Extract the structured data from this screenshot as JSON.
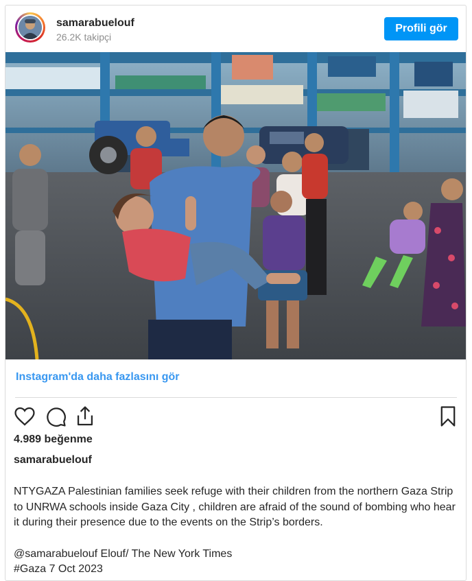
{
  "post": {
    "username": "samarabuelouf",
    "followers": "26.2K takipçi",
    "profile_button": "Profili gör",
    "photo_icon": "photo-children-refuge-school",
    "more_link": "Instagram'da daha fazlasını gör",
    "likes": "4.989 beğenme",
    "caption_user": "samarabuelouf",
    "caption_text": "NTYGAZA Palestinian families seek refuge with their children from the northern Gaza Strip to UNRWA schools inside Gaza City , children are afraid of the sound of bombing who hear it during their presence due to the events on the Strip’s borders.",
    "credit": "@samarabuelouf Elouf/ The New York Times",
    "tag": "#Gaza 7 Oct 2023"
  },
  "icons": {
    "like": "heart-icon",
    "comment": "comment-icon",
    "share": "share-icon",
    "save": "bookmark-icon"
  },
  "colors": {
    "accent": "#0095f6",
    "link": "#3897f0",
    "text": "#262626",
    "muted": "#8e8e8e",
    "border": "#dbdbdb"
  }
}
